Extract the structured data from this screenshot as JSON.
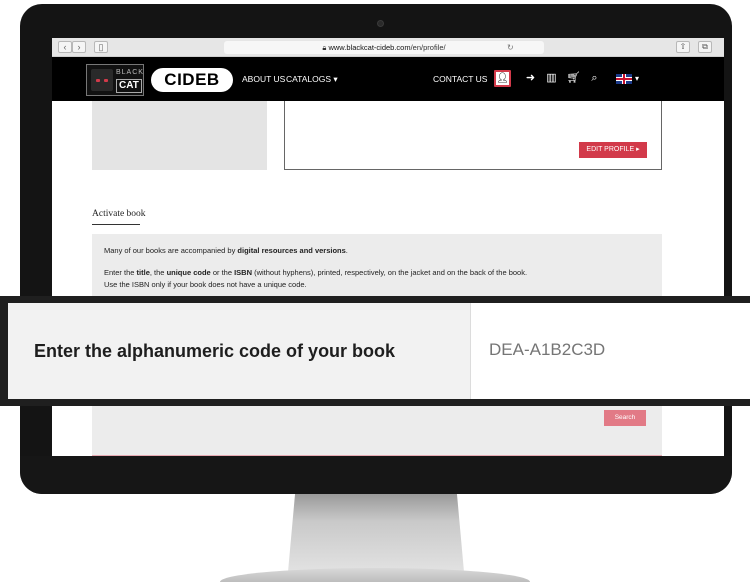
{
  "browser": {
    "url_host": "www.blackcat-cideb.com",
    "url_path": "/en/profile/"
  },
  "site": {
    "logo_black": "BLACK",
    "logo_cat": "CAT",
    "logo_cideb": "CIDEB",
    "menu": {
      "about": "ABOUT US",
      "catalogs": "CATALOGS",
      "contact": "CONTACT US"
    }
  },
  "profile": {
    "edit_label": "EDIT PROFILE"
  },
  "activate": {
    "title": "Activate book",
    "line1_pre": "Many of our books are accompanied by ",
    "line1_bold": "digital resources and versions",
    "line1_post": ".",
    "line2_a": "Enter the ",
    "line2_b": "title",
    "line2_c": ", the ",
    "line2_d": "unique code",
    "line2_e": " or the ",
    "line2_f": "ISBN",
    "line2_g": " (without hyphens), printed, respectively, on the jacket and on the back of the book.",
    "line3": "Use the ISBN only if your book does not have a unique code.",
    "search_label": "Search"
  },
  "callout": {
    "label": "Enter the alphanumeric code of your book",
    "placeholder": "DEA-A1B2C3D"
  },
  "colors": {
    "accent_red": "#d23a4a",
    "search_pink": "#e27a86",
    "nav_black": "#000000",
    "panel_gray": "#ececec"
  }
}
